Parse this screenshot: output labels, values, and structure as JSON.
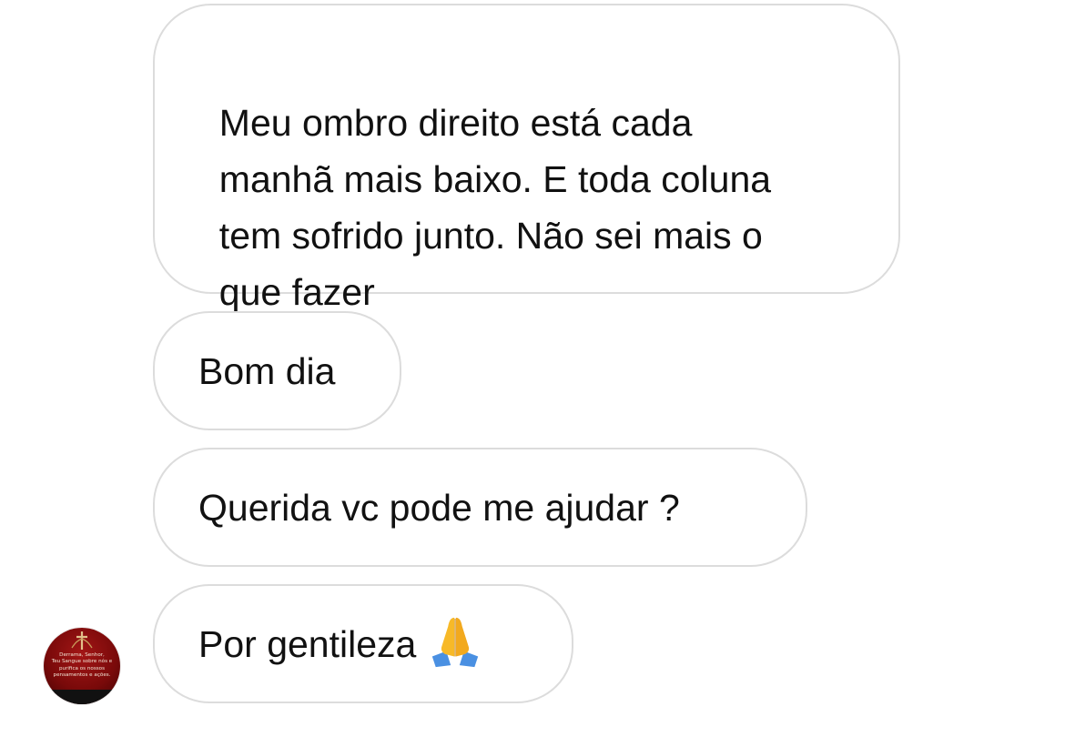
{
  "conversation": {
    "messages": [
      {
        "text": "Meu ombro direito está cada\nmanhã mais baixo. E toda coluna\ntem sofrido junto. Não sei mais o\nque fazer"
      },
      {
        "text": "Bom dia"
      },
      {
        "text": "Querida vc pode me ajudar ?"
      },
      {
        "text": "Por gentileza",
        "emoji": "folded-hands-emoji"
      }
    ],
    "sender_avatar": {
      "caption": "Derrama, Senhor,\nTeu Sangue sobre nós e\npurifica os nossos\npensamentos e ações.",
      "background_color": "#7a0a0a",
      "icon": "cross-icon"
    }
  },
  "colors": {
    "bubble_border": "#dcdcdc",
    "text": "#111111",
    "background": "#ffffff"
  }
}
